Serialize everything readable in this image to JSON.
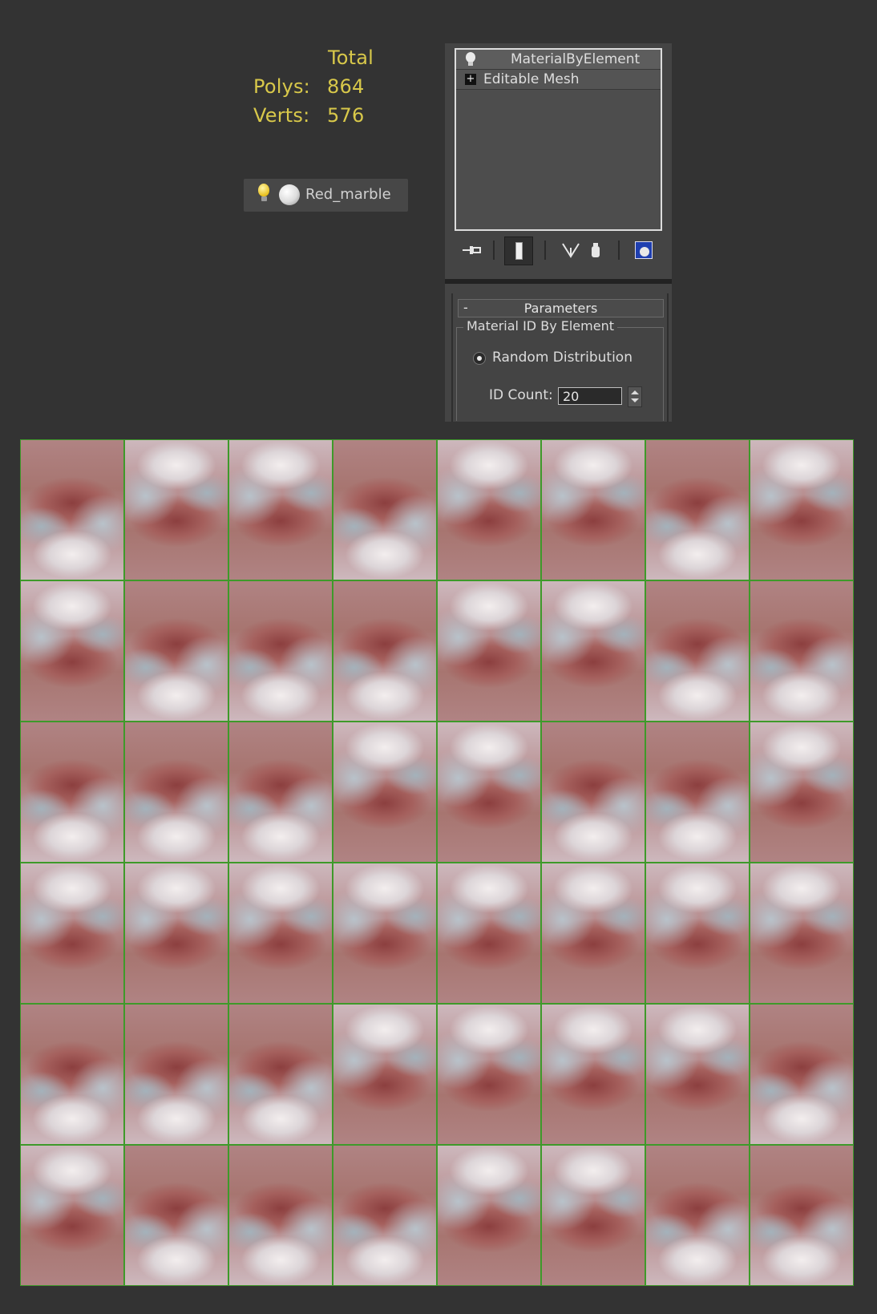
{
  "stats": {
    "header": "Total",
    "polys_label": "Polys:",
    "polys_value": "864",
    "verts_label": "Verts:",
    "verts_value": "576"
  },
  "material": {
    "name": "Red_marble",
    "icons": [
      "lightbulb-icon",
      "material-sphere-icon"
    ]
  },
  "modifier_stack": {
    "items": [
      {
        "label": "MaterialByElement",
        "icon": "lightbulb-icon"
      },
      {
        "label": "Editable Mesh",
        "icon": "plus-icon"
      }
    ],
    "toolbar": [
      "pin-stack-icon",
      "show-end-result-icon",
      "make-unique-icon",
      "remove-modifier-icon",
      "configure-modifier-sets-icon"
    ]
  },
  "rollout": {
    "collapse_symbol": "-",
    "title": "Parameters",
    "group_label": "Material ID By Element",
    "radio_label": "Random Distribution",
    "id_count_label": "ID Count:",
    "id_count_value": "20"
  },
  "viewport": {
    "columns": 8,
    "rows": 6,
    "grid_color": "#3e9a2a",
    "tile_pattern": [
      [
        "a",
        "b",
        "b",
        "a",
        "b",
        "b",
        "a",
        "b"
      ],
      [
        "b",
        "a",
        "a",
        "a",
        "b",
        "b",
        "a",
        "a"
      ],
      [
        "a",
        "a",
        "a",
        "b",
        "b",
        "a",
        "a",
        "b"
      ],
      [
        "b",
        "b",
        "b",
        "b",
        "b",
        "b",
        "b",
        "b"
      ],
      [
        "a",
        "a",
        "a",
        "b",
        "b",
        "b",
        "b",
        "a"
      ],
      [
        "b",
        "a",
        "a",
        "a",
        "b",
        "b",
        "a",
        "a"
      ]
    ]
  }
}
